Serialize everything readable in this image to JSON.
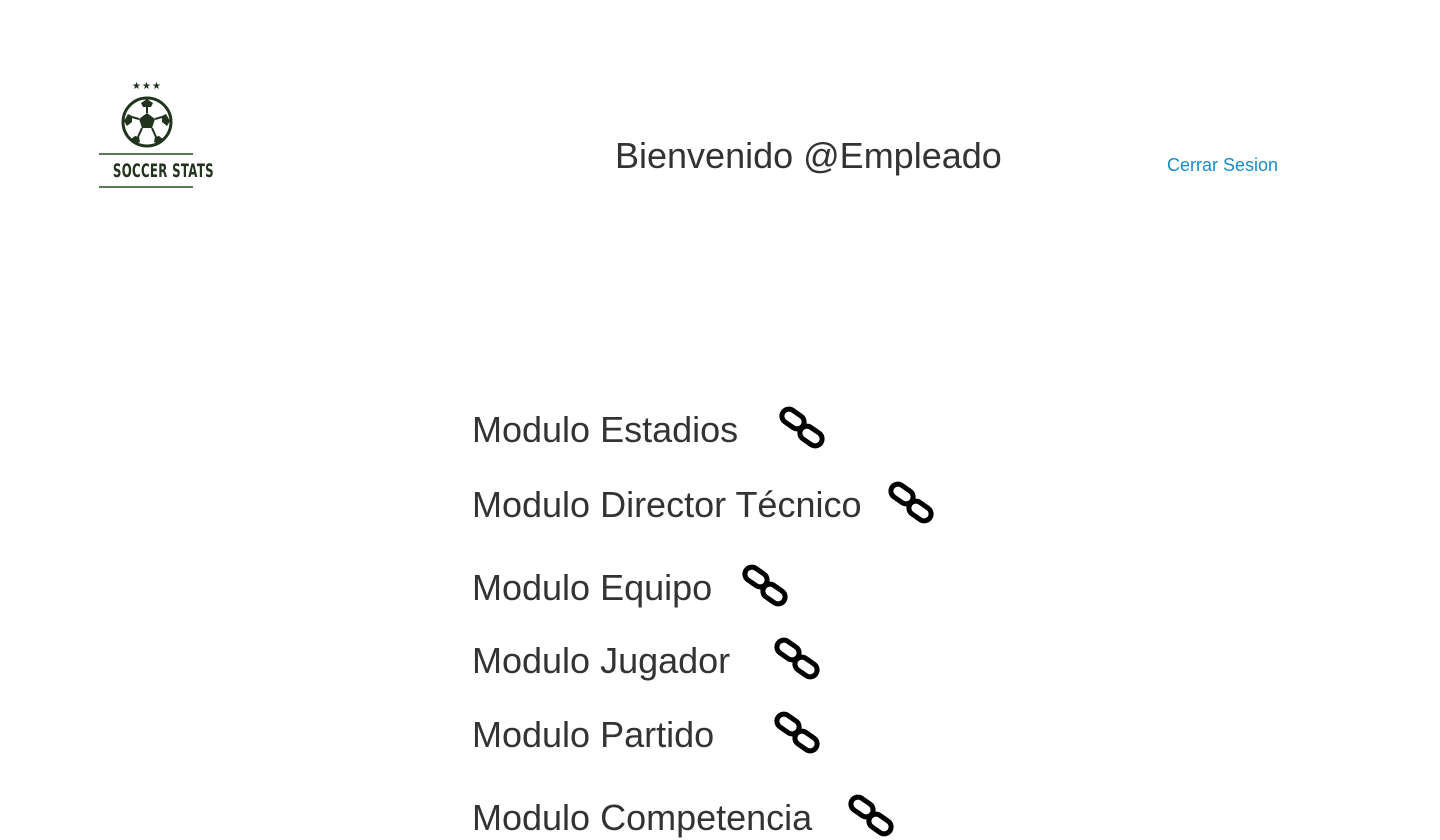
{
  "header": {
    "logo": {
      "stars": "★★★",
      "brand": "SOCCER STATS",
      "icon": "soccer-ball-icon",
      "color": "#22331e"
    },
    "welcome_text": "Bienvenido @Empleado",
    "logout_label": "Cerrar Sesion",
    "link_color": "#1b8ac8"
  },
  "modules": [
    {
      "label": "Modulo Estadios",
      "icon": "link-icon"
    },
    {
      "label": "Modulo Director Técnico",
      "icon": "link-icon"
    },
    {
      "label": "Modulo Equipo",
      "icon": "link-icon"
    },
    {
      "label": "Modulo Jugador",
      "icon": "link-icon"
    },
    {
      "label": "Modulo Partido",
      "icon": "link-icon"
    },
    {
      "label": "Modulo Competencia",
      "icon": "link-icon"
    }
  ]
}
